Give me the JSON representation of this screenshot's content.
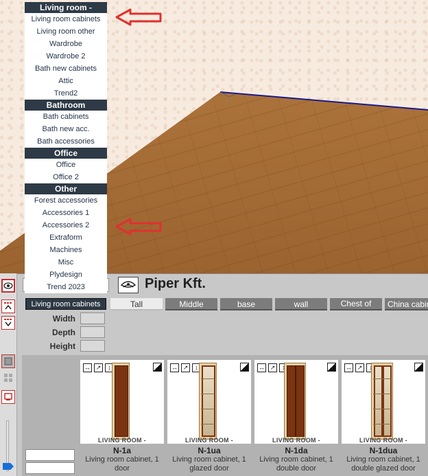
{
  "menu": {
    "sections": [
      {
        "header": "Living room -",
        "items": [
          "Living room cabinets",
          "Living room other",
          "Wardrobe",
          "Wardrobe 2",
          "Bath new cabinets",
          "Attic",
          "Trend2"
        ]
      },
      {
        "header": "Bathroom",
        "items": [
          "Bath cabinets",
          "Bath new acc.",
          "Bath accessories"
        ]
      },
      {
        "header": "Office",
        "items": [
          "Office",
          "Office 2"
        ]
      },
      {
        "header": "Other",
        "items": [
          "Forest accessories",
          "Accessories 1",
          "Accessories 2",
          "Extraform",
          "Machines",
          "Misc",
          "Plydesign",
          "Trend 2023"
        ]
      }
    ]
  },
  "toolbar": {
    "brand": "Piper Kft.",
    "selected_category": "Living room cabinets"
  },
  "tabs": [
    "Tall",
    "Middle",
    "base",
    "wall",
    "Chest of",
    "China cabine"
  ],
  "dimensions": {
    "width_label": "Width",
    "depth_label": "Depth",
    "height_label": "Height"
  },
  "products": [
    {
      "tag": "LIVING ROOM -",
      "code": "N-1a",
      "desc": "Living room cabinet, 1 door"
    },
    {
      "tag": "LIVING ROOM -",
      "code": "N-1ua",
      "desc": "Living room cabinet, 1 glazed door"
    },
    {
      "tag": "LIVING ROOM -",
      "code": "N-1da",
      "desc": "Living room cabinet, 1 double door"
    },
    {
      "tag": "LIVING ROOM -",
      "code": "N-1dua",
      "desc": "Living room cabinet, 1 double glazed door"
    }
  ],
  "icons": {
    "eye": "eye-icon",
    "card_tools": [
      "resize-width-icon",
      "resize-depth-icon",
      "resize-height-icon"
    ],
    "card_corner": "corner-toggle-icon",
    "arrow": "red-arrow-icon"
  },
  "colors": {
    "menu_header_bg": "#2e3a46",
    "menu_text": "#24344a",
    "tab_bg": "#7c7c7c",
    "arrow": "#e03030",
    "cabinet_wood": "#7b3312"
  }
}
